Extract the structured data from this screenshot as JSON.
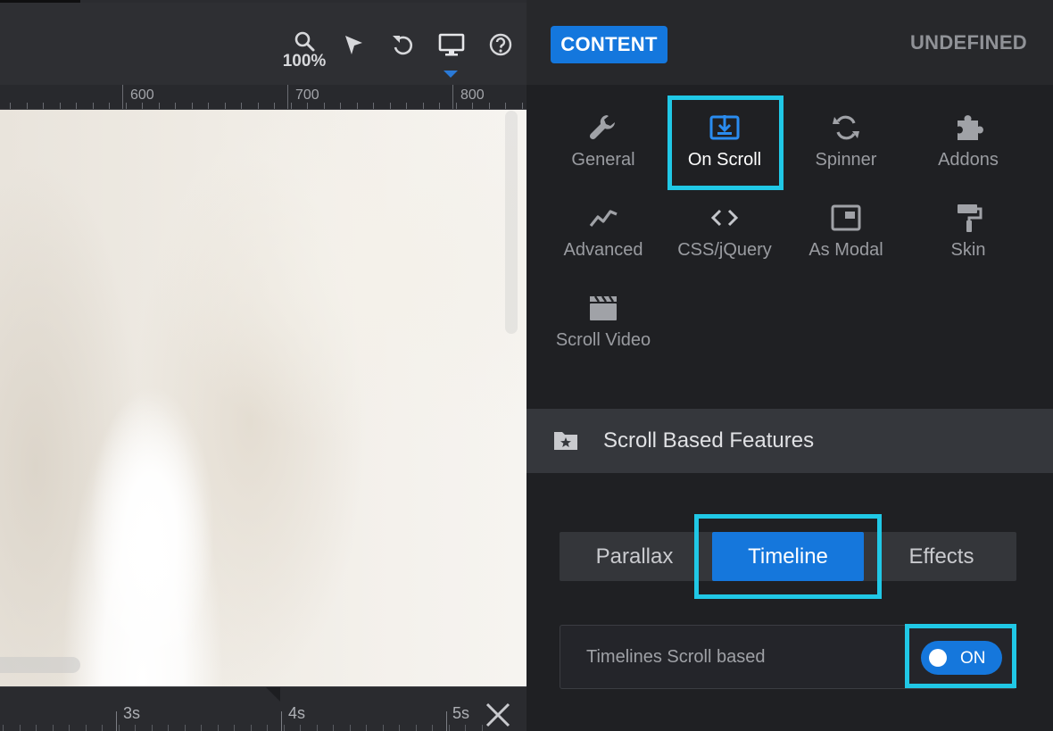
{
  "toolbar": {
    "zoom_label": "100%",
    "tools": [
      "search-icon",
      "pointer-icon",
      "undo-icon",
      "desktop-icon",
      "help-icon"
    ]
  },
  "ruler": {
    "labels": [
      "600",
      "700",
      "800"
    ]
  },
  "timeline": {
    "labels": [
      "3s",
      "4s",
      "5s"
    ]
  },
  "panel": {
    "content_button": "CONTENT",
    "undefined_label": "UNDEFINED",
    "menu": [
      {
        "label": "General",
        "icon": "wrench-icon"
      },
      {
        "label": "On Scroll",
        "icon": "scroll-download-icon"
      },
      {
        "label": "Spinner",
        "icon": "refresh-icon"
      },
      {
        "label": "Addons",
        "icon": "puzzle-icon"
      },
      {
        "label": "Advanced",
        "icon": "chart-line-icon"
      },
      {
        "label": "CSS/jQuery",
        "icon": "code-icon"
      },
      {
        "label": "As Modal",
        "icon": "modal-icon"
      },
      {
        "label": "Skin",
        "icon": "paint-roller-icon"
      },
      {
        "label": "Scroll Video",
        "icon": "clapperboard-icon"
      }
    ],
    "section_title": "Scroll Based Features",
    "tabs": [
      "Parallax",
      "Timeline",
      "Effects"
    ],
    "option": {
      "label": "Timelines Scroll based",
      "toggle_text": "ON"
    }
  },
  "colors": {
    "accent": "#1577dc",
    "highlight": "#20c8e6"
  }
}
